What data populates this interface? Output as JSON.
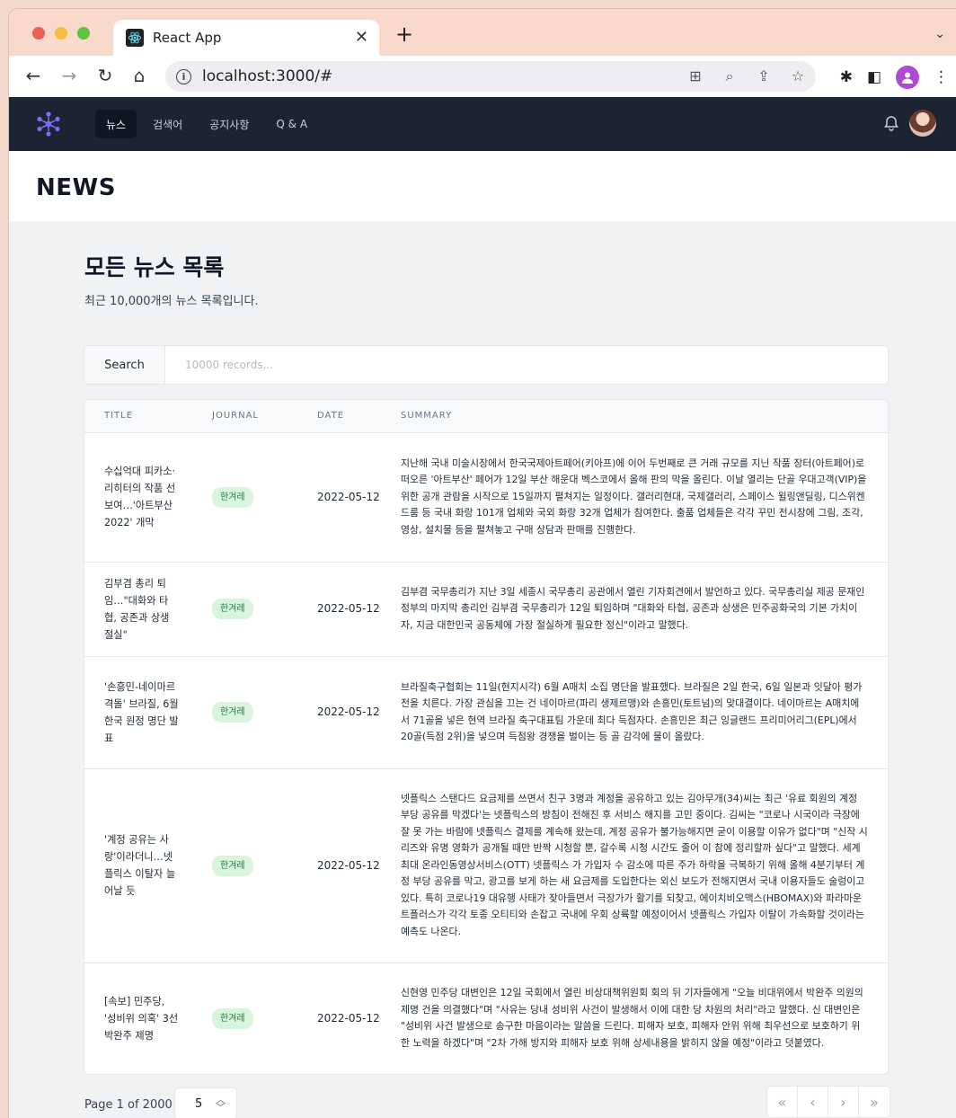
{
  "browser": {
    "tab_title": "React App",
    "url": "localhost:3000/#"
  },
  "nav": {
    "links": [
      "뉴스",
      "검색어",
      "공지사항",
      "Q & A"
    ]
  },
  "page": {
    "heading": "NEWS",
    "section_title": "모든 뉴스 목록",
    "section_subtitle": "최근 10,000개의 뉴스 목록입니다."
  },
  "search": {
    "label": "Search",
    "placeholder": "10000 records..."
  },
  "table": {
    "headers": [
      "TITLE",
      "JOURNAL",
      "DATE",
      "SUMMARY"
    ],
    "rows": [
      {
        "title": "수십억대 피카소·리히터의 작품 선보여…'아트부산 2022' 개막",
        "journal": "한겨레",
        "date": "2022-05-12",
        "summary": "지난해 국내 미술시장에서 한국국제아트페어(키아프)에 이어 두번째로 큰 거래 규모를 지닌 작품 장터(아트페어)로 떠오른 '아트부산' 페어가 12일 부산 해운대 벡스코에서 올해 판의 막을 올린다. 이날 열리는 단골 우대고객(VIP)을 위한 공개 관람을 시작으로 15일까지 펼쳐지는 일정이다. 갤러리현대, 국제갤러리, 스페이스 윌링앤딜링, 디스위켄드룸 등 국내 화랑 101개 업체와 국외 화랑 32개 업체가 참여한다. 출품 업체들은 각각 꾸민 전시장에 그림, 조각, 영상, 설치물 등을 펼쳐놓고 구매 상담과 판매를 진행한다."
      },
      {
        "title": "김부겸 총리 퇴임…\"대화와 타협, 공존과 상생 절실\"",
        "journal": "한겨레",
        "date": "2022-05-12",
        "summary": "김부겸 국무총리가 지난 3일 세종시 국무총리 공관에서 열린 기자회견에서 발언하고 있다. 국무총리실 제공 문재인 정부의 마지막 총리인 김부겸 국무총리가 12일 퇴임하며 \"대화와 타협, 공존과 상생은 민주공화국의 기본 가치이자, 지금 대한민국 공동체에 가장 절실하게 필요한 정신\"이라고 말했다."
      },
      {
        "title": "'손흥민-네이마르 격돌' 브라질, 6월 한국 원정 명단 발표",
        "journal": "한겨레",
        "date": "2022-05-12",
        "summary": "브라질축구협회는 11일(현지시각) 6월 A매치 소집 명단을 발표했다. 브라질은 2일 한국, 6일 일본과 잇달아 평가전을 치른다. 가장 관심을 끄는 건 네이마르(파리 생제르맹)와 손흥민(토트넘)의 맞대결이다. 네이마르는 A매치에서 71골을 넣은 현역 브라질 축구대표팀 가운데 최다 득점자다. 손흥민은 최근 잉글랜드 프리미어리그(EPL)에서 20골(득점 2위)을 넣으며 득점왕 경쟁을 벌이는 등 골 감각에 물이 올랐다."
      },
      {
        "title": "'계정 공유는 사랑'이라더니…넷플릭스 이탈자 늘어날 듯",
        "journal": "한겨레",
        "date": "2022-05-12",
        "summary": "넷플릭스 스탠다드 요금제를 쓰면서 친구 3명과 계정을 공유하고 있는 김아무개(34)씨는 최근 '유료 회원의 계정 부당 공유를 막겠다'는 넷플릭스의 방침이 전해진 후 서비스 해지를 고민 중이다. 김씨는 \"코로나 시국이라 극장에 잘 못 가는 바람에 넷플릭스 결제를 계속해 왔는데, 계정 공유가 불가능해지면 굳이 이용할 이유가 없다\"며 \"신작 시리즈와 유명 영화가 공개될 때만 반짝 시청할 뿐, 갈수록 시청 시간도 줄어 이 참에 정리할까 싶다\"고 말했다. 세계 최대 온라인동영상서비스(OTT) 넷플릭스 가 가입자 수 감소에 따른 주가 하락을 극복하기 위해 올해 4분기부터 계정 부당 공유를 막고, 광고를 보게 하는 새 요금제를 도입한다는 외신 보도가 전해지면서 국내 이용자들도 술렁이고 있다. 특히 코로나19 대유행 사태가 잦아들면서 극장가가 활기를 되찾고, 에이치비오맥스(HBOMAX)와 파라마운트플러스가 각각 토종 오티티와 손잡고 국내에 우회 상륙할 예정이어서 넷플릭스 가입자 이탈이 가속화할 것이라는 예측도 나온다."
      },
      {
        "title": "[속보] 민주당, '성비위 의혹' 3선 박완주 제명",
        "journal": "한겨레",
        "date": "2022-05-12",
        "summary": "신현영 민주당 대변인은 12일 국회에서 열린 비상대책위원회 회의 뒤 기자들에게 \"오늘 비대위에서 박완주 의원의 제명 건을 의결했다\"며 \"사유는 당내 성비위 사건이 발생해서 이에 대한 당 차원의 처리\"라고 말했다. 신 대변인은 \"성비위 사건 발생으로 송구한 마음이라는 말씀을 드린다. 피해자 보호, 피해자 안위 위해 최우선으로 보호하기 위한 노력을 하겠다\"며 \"2차 가해 방지와 피해자 보호 위해 상세내용을 밝히지 않을 예정\"이라고 덧붙였다."
      }
    ]
  },
  "pagination": {
    "info": "Page 1 of 2000",
    "page_size": "5",
    "controls": [
      "«",
      "‹",
      "›",
      "»"
    ]
  },
  "colors": {
    "navbar": "#1c2433",
    "badge_bg": "#d9f5de",
    "badge_text": "#1e7b3a",
    "accent": "#6d5dfc"
  }
}
